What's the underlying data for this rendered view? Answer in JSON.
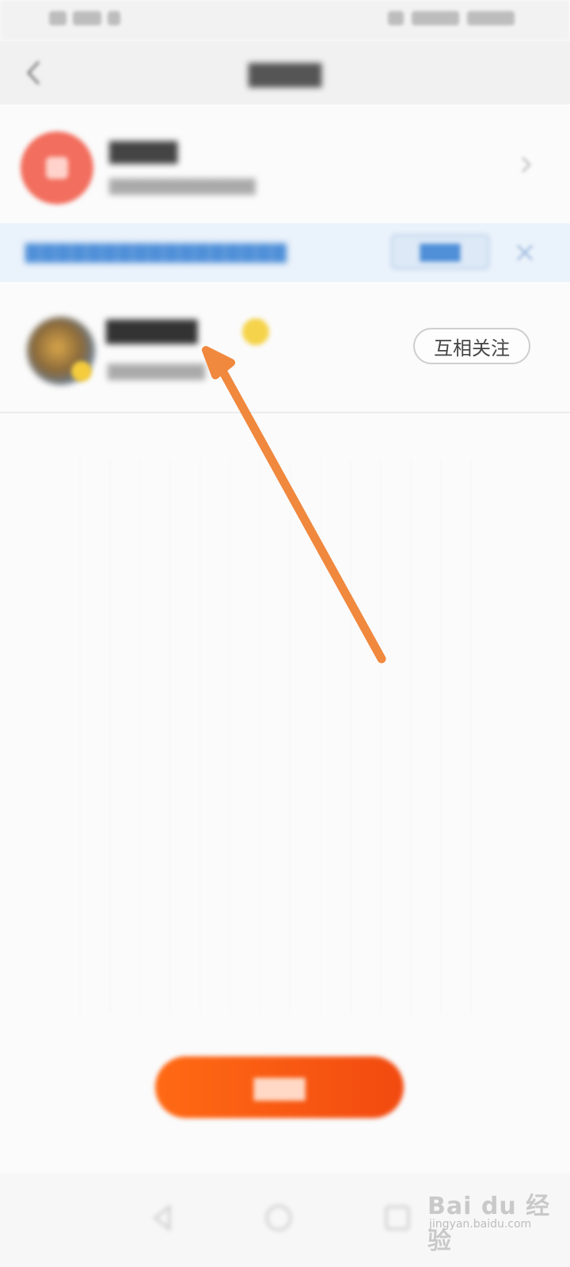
{
  "status_bar": {
    "left_text": "",
    "right_text": ""
  },
  "header": {
    "title": "",
    "back_icon": "back-arrow-icon"
  },
  "message_row": {
    "title": "",
    "subtitle": "",
    "avatar_color": "#f26e5e"
  },
  "banner": {
    "text": "",
    "button_label": "",
    "close_icon": "close-icon",
    "text_color": "#4f8fd8"
  },
  "user_row": {
    "name": "",
    "subtitle": "",
    "follow_label": "互相关注"
  },
  "bottom_button": {
    "label": "",
    "color": "#f24a10"
  },
  "nav": {
    "icons": [
      "nav-back-icon",
      "nav-home-icon",
      "nav-recent-icon"
    ]
  },
  "watermark": {
    "brand": "Bai du 经验",
    "url": "jingyan.baidu.com"
  },
  "annotation": {
    "arrow_color": "#f0883e"
  }
}
